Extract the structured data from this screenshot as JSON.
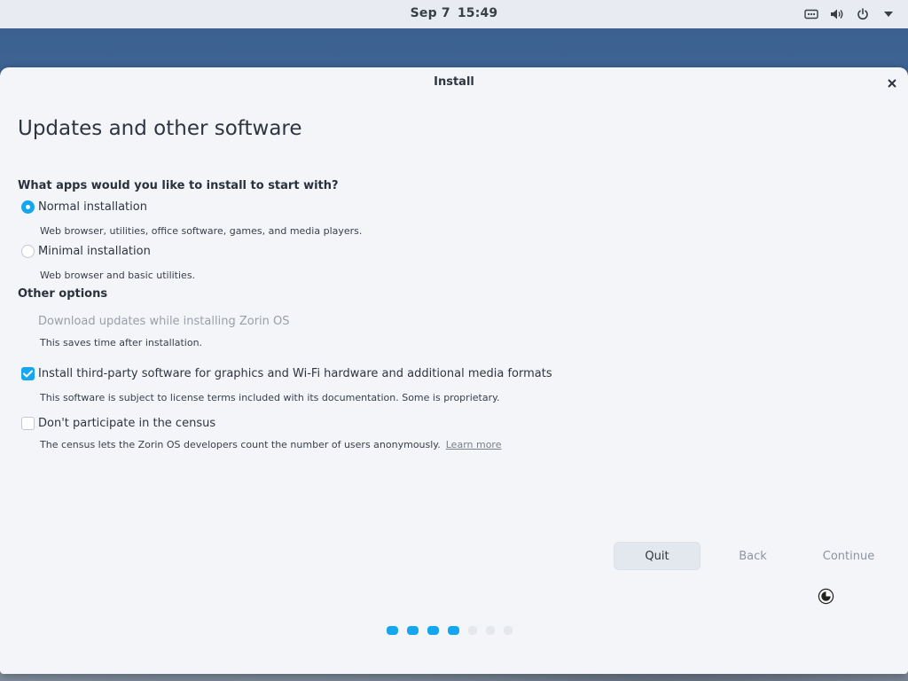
{
  "topbar": {
    "date": "Sep 7",
    "time": "15:49",
    "tray_icons": [
      "network-icon",
      "volume-icon",
      "power-icon",
      "menu-arrow-icon"
    ]
  },
  "window": {
    "title": "Install",
    "close_glyph": "✕"
  },
  "page": {
    "heading": "Updates and other software",
    "apps_question": "What apps would you like to install to start with?",
    "install_options": [
      {
        "label": "Normal installation",
        "description": "Web browser, utilities, office software, games, and media players.",
        "selected": true
      },
      {
        "label": "Minimal installation",
        "description": "Web browser and basic utilities.",
        "selected": false
      }
    ],
    "other_options_label": "Other options",
    "other_options": [
      {
        "label": "Download updates while installing Zorin OS",
        "description": "This saves time after installation.",
        "checked": false,
        "disabled": true
      },
      {
        "label": "Install third-party software for graphics and Wi-Fi hardware and additional media formats",
        "description": "This software is subject to license terms included with its documentation. Some is proprietary.",
        "checked": true,
        "disabled": false
      },
      {
        "label": "Don't participate in the census",
        "description": "The census lets the Zorin OS developers count the number of users anonymously.",
        "link": "Learn more",
        "checked": false,
        "disabled": false
      }
    ]
  },
  "buttons": {
    "quit": "Quit",
    "back": "Back",
    "continue": "Continue"
  },
  "progress": {
    "current_step": 4,
    "total_steps": 7
  },
  "colors": {
    "accent": "#15a6f0",
    "dialog_bg": "#f3f5f9",
    "topbar_bg": "#e8ecf2"
  }
}
